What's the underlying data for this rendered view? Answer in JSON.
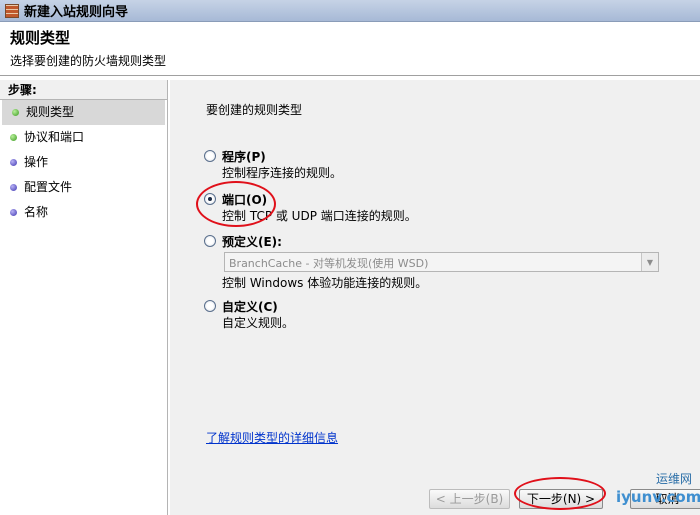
{
  "window": {
    "title": "新建入站规则向导"
  },
  "header": {
    "title": "规则类型",
    "subtitle": "选择要创建的防火墙规则类型"
  },
  "sidebar": {
    "heading": "步骤:",
    "items": [
      {
        "label": "规则类型",
        "dot": "green",
        "selected": true
      },
      {
        "label": "协议和端口",
        "dot": "green",
        "selected": false
      },
      {
        "label": "操作",
        "dot": "purple",
        "selected": false
      },
      {
        "label": "配置文件",
        "dot": "purple",
        "selected": false
      },
      {
        "label": "名称",
        "dot": "purple",
        "selected": false
      }
    ]
  },
  "main": {
    "question": "要创建的规则类型",
    "options": [
      {
        "label": "程序(P)",
        "description": "控制程序连接的规则。",
        "checked": false
      },
      {
        "label": "端口(O)",
        "description": "控制 TCP 或 UDP 端口连接的规则。",
        "checked": true
      },
      {
        "label": "预定义(E):",
        "description": "控制 Windows 体验功能连接的规则。",
        "checked": false
      },
      {
        "label": "自定义(C)",
        "description": "自定义规则。",
        "checked": false
      }
    ],
    "predefined_select": {
      "value": "BranchCache - 对等机发现(使用 WSD)"
    },
    "learn_link": "了解规则类型的详细信息"
  },
  "buttons": {
    "back": "< 上一步(B)",
    "next": "下一步(N) >",
    "cancel": "取消"
  },
  "watermark": {
    "line1": "运维网",
    "line2": "iyunv.com"
  },
  "colors": {
    "annotation": "#e0101a",
    "link": "#0033cc",
    "panel": "#f0f0f0"
  }
}
